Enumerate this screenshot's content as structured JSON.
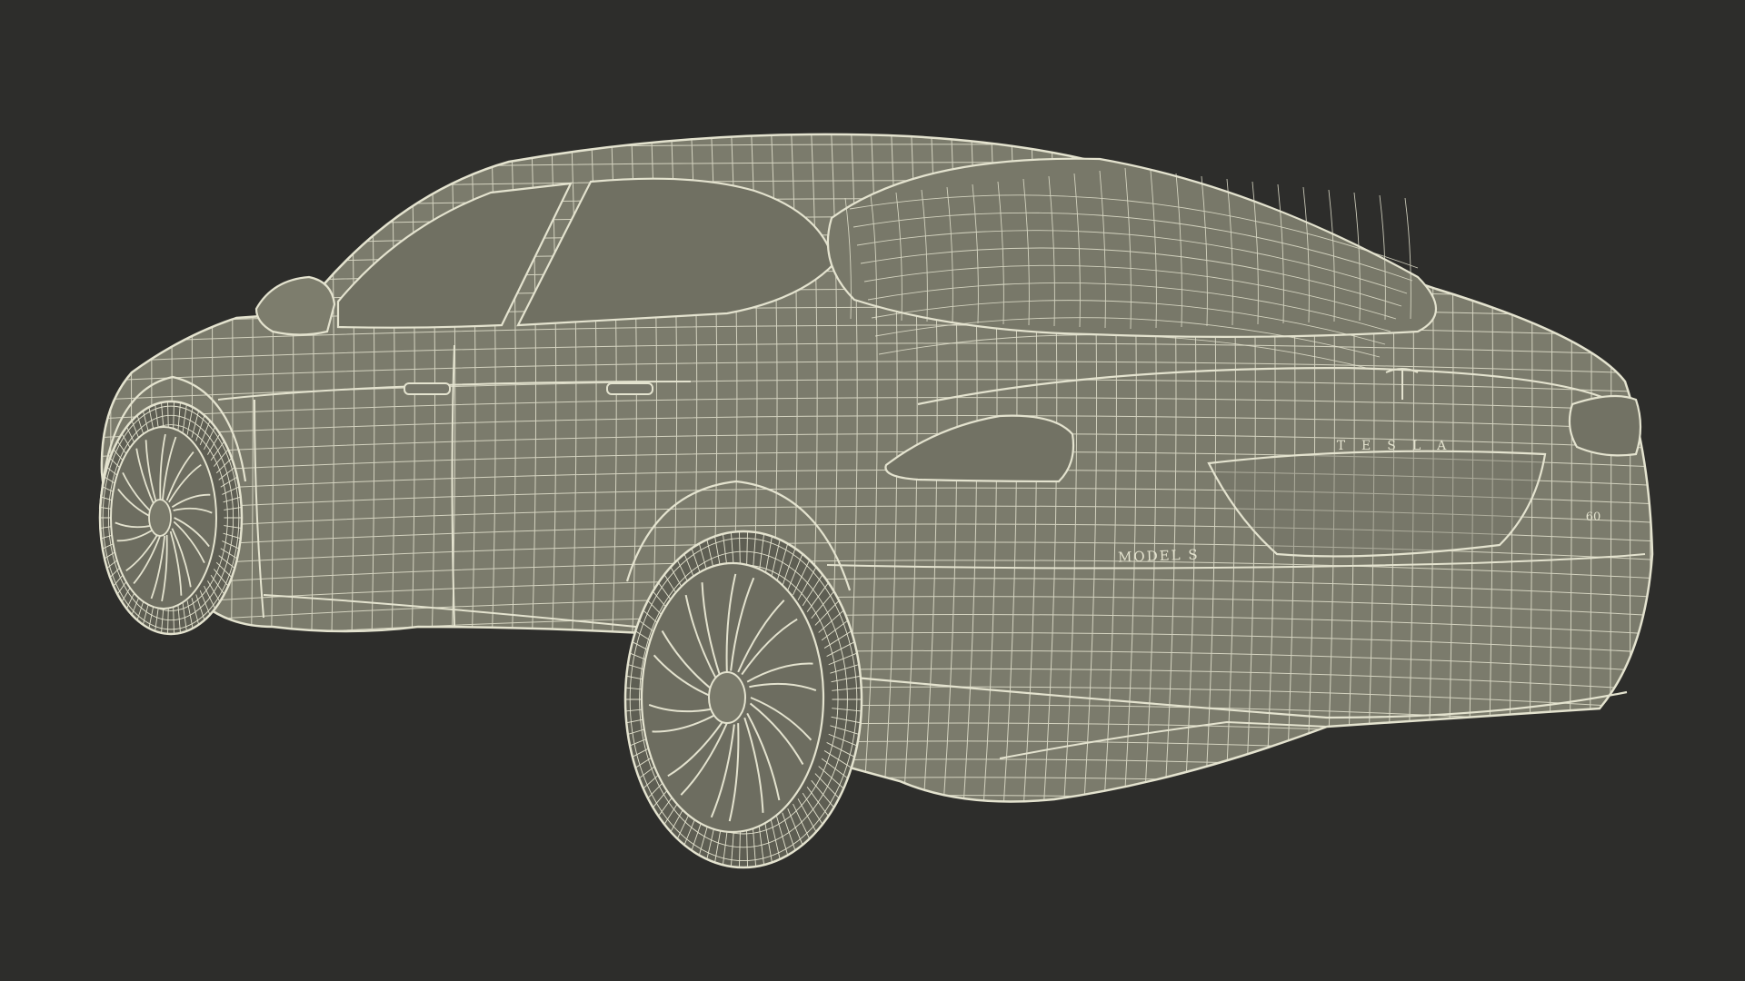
{
  "image": {
    "subject": "car-wireframe-render",
    "colors": {
      "background": "#2d2d2b",
      "body": "#7b7b6c",
      "body_shade": "#6e6e60",
      "wire": "#e4e3cf",
      "tire": "#5e5e53"
    },
    "badges": {
      "brand": "TESLA",
      "model": "MODEL S",
      "trim": "60"
    }
  }
}
